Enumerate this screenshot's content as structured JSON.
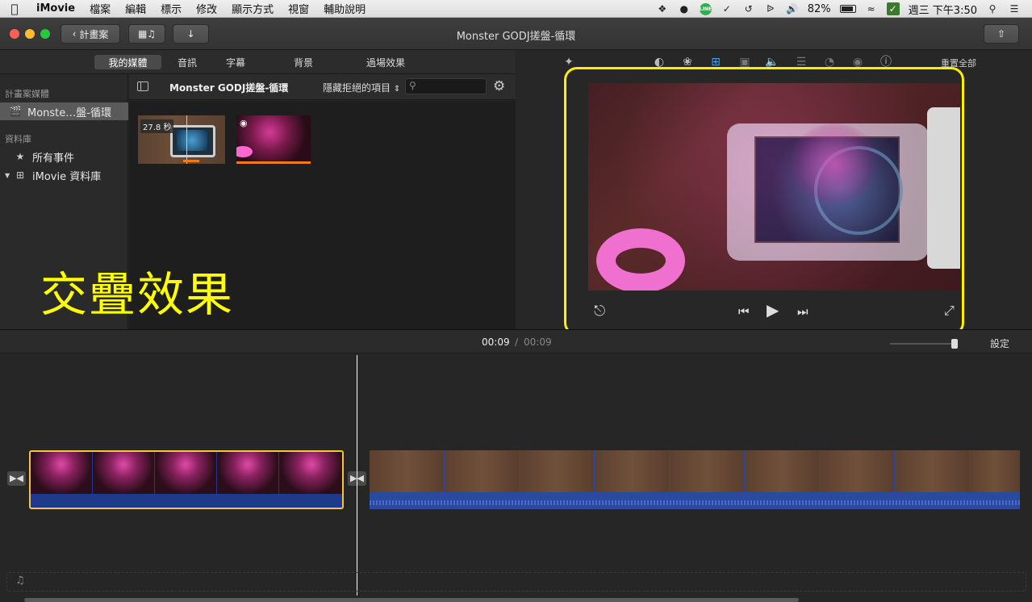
{
  "menubar": {
    "app_name": "iMovie",
    "items": [
      "檔案",
      "編輯",
      "標示",
      "修改",
      "顯示方式",
      "視窗",
      "輔助說明"
    ],
    "battery": "82%",
    "clock": "週三 下午3:50"
  },
  "titlebar": {
    "back_label": "計畫案",
    "title": "Monster GODJ搓盤-循環"
  },
  "browser_tabs": [
    "我的媒體",
    "音訊",
    "字幕",
    "背景",
    "過場效果"
  ],
  "sidebar": {
    "project_media_heading": "計畫案媒體",
    "project_item": "Monste…盤-循環",
    "library_heading": "資料庫",
    "all_events": "所有事件",
    "library": "iMovie 資料庫"
  },
  "media_browser": {
    "event_title": "Monster GODJ搓盤-循環",
    "filter_label": "隱藏拒絕的項目",
    "search_placeholder": "",
    "clips": [
      {
        "duration": "27.8 秒"
      }
    ]
  },
  "overlay_caption": "交疊效果",
  "viewer": {
    "reset_all": "重置全部"
  },
  "timeline": {
    "current_time": "00:09",
    "separator": "/",
    "total_time": "00:09",
    "settings_label": "設定"
  },
  "colors": {
    "highlight_yellow": "#ffee00",
    "selected_clip_border": "#f5c542",
    "audio_blue": "#1f3a8a"
  }
}
